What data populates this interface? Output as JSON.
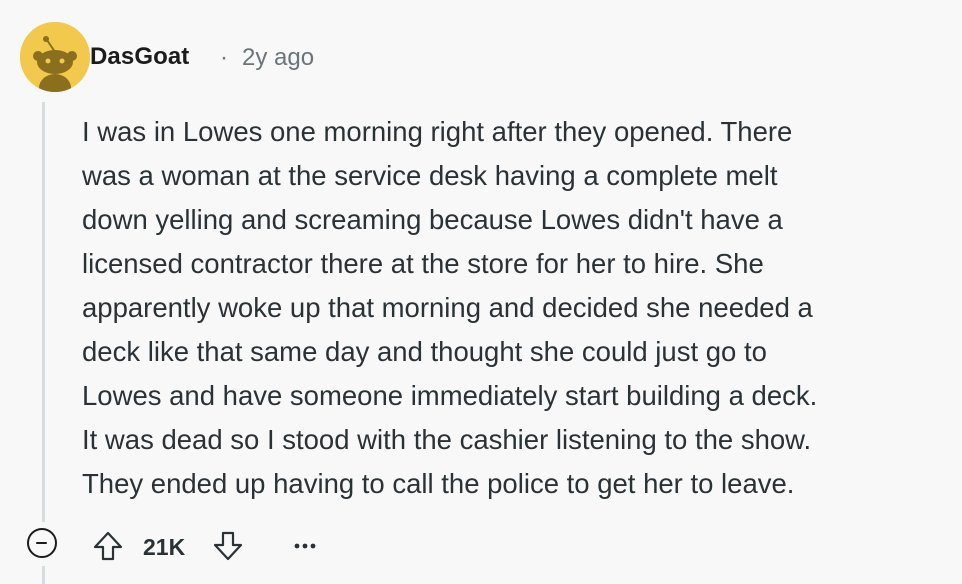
{
  "comment": {
    "username": "DasGoat",
    "separator": "·",
    "timestamp": "2y ago",
    "body_lines": [
      "I was in Lowes one morning right after they opened. There",
      "was a woman at the service desk having a complete melt",
      "down yelling and screaming because Lowes didn't have a",
      "licensed contractor there at the store for her to hire. She",
      "apparently woke up that morning and decided she needed a",
      "deck like that same day and thought she could just go to",
      "Lowes and have someone immediately start building a deck.",
      "It was dead so I stood with the cashier listening to the show.",
      "They ended up having to call the police to get her to leave."
    ],
    "vote_count": "21K",
    "more_label": "···"
  },
  "colors": {
    "background": "#f8f8f8",
    "avatar_bg": "#f2c94c",
    "text": "#2a3236",
    "muted": "#6b7478",
    "thread_line": "#d7dcdf"
  },
  "icons": {
    "avatar": "reddit-snoo-avatar-icon",
    "collapse": "collapse-minus-icon",
    "upvote": "upvote-arrow-icon",
    "downvote": "downvote-arrow-icon",
    "more": "more-options-icon"
  }
}
